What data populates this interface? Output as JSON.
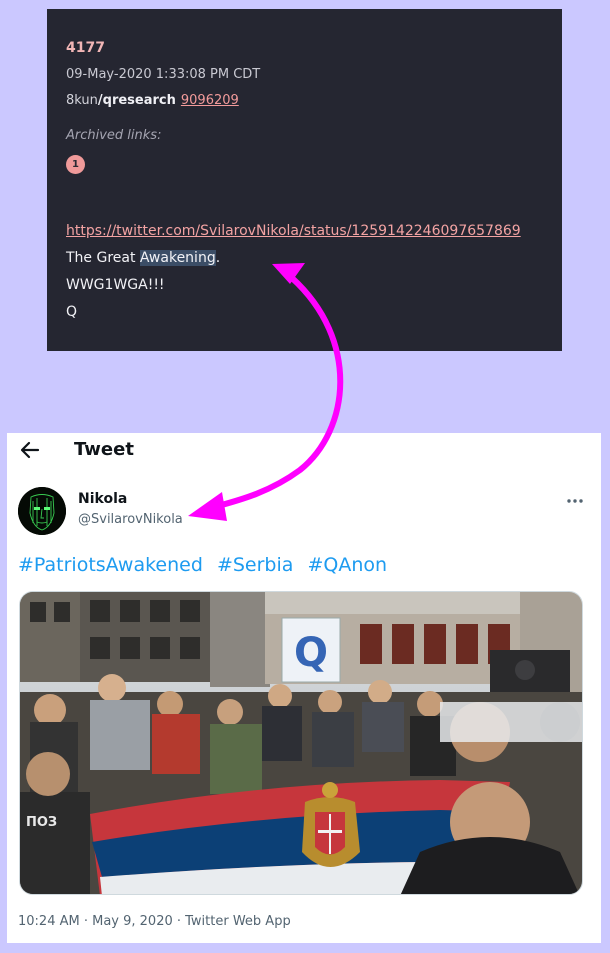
{
  "post": {
    "number": "4177",
    "datetime": "09-May-2020 1:33:08 PM CDT",
    "site": "8kun",
    "board": "/qresearch",
    "thread_id": "9096209",
    "archived_label": "Archived links:",
    "archived_badge": "1",
    "link": "https://twitter.com/SvilarovNikola/status/1259142246097657869",
    "line1_prefix": "The Great ",
    "line1_highlight": "Awakening",
    "line1_suffix": ".",
    "line2": "WWG1WGA!!!",
    "line3": "Q"
  },
  "tweet": {
    "header_title": "Tweet",
    "name": "Nikola",
    "handle": "@SvilarovNikola",
    "hashtags": [
      "#PatriotsAwakened",
      "#Serbia",
      "#QAnon"
    ],
    "photo_sign_letter": "Q",
    "photo_banner_text": "ПОЗ",
    "meta": "10:24 AM · May 9, 2020 · Twitter Web App"
  },
  "colors": {
    "page_bg": "#cbc8ff",
    "post_bg": "#252631",
    "post_link": "#f3a3a3",
    "twitter_blue": "#1d9bf0",
    "annotation_arrow": "#ff00ff"
  },
  "icons": {
    "back": "back-arrow-icon",
    "more": "more-horizontal-icon",
    "annotation": "double-headed-curved-arrow"
  }
}
